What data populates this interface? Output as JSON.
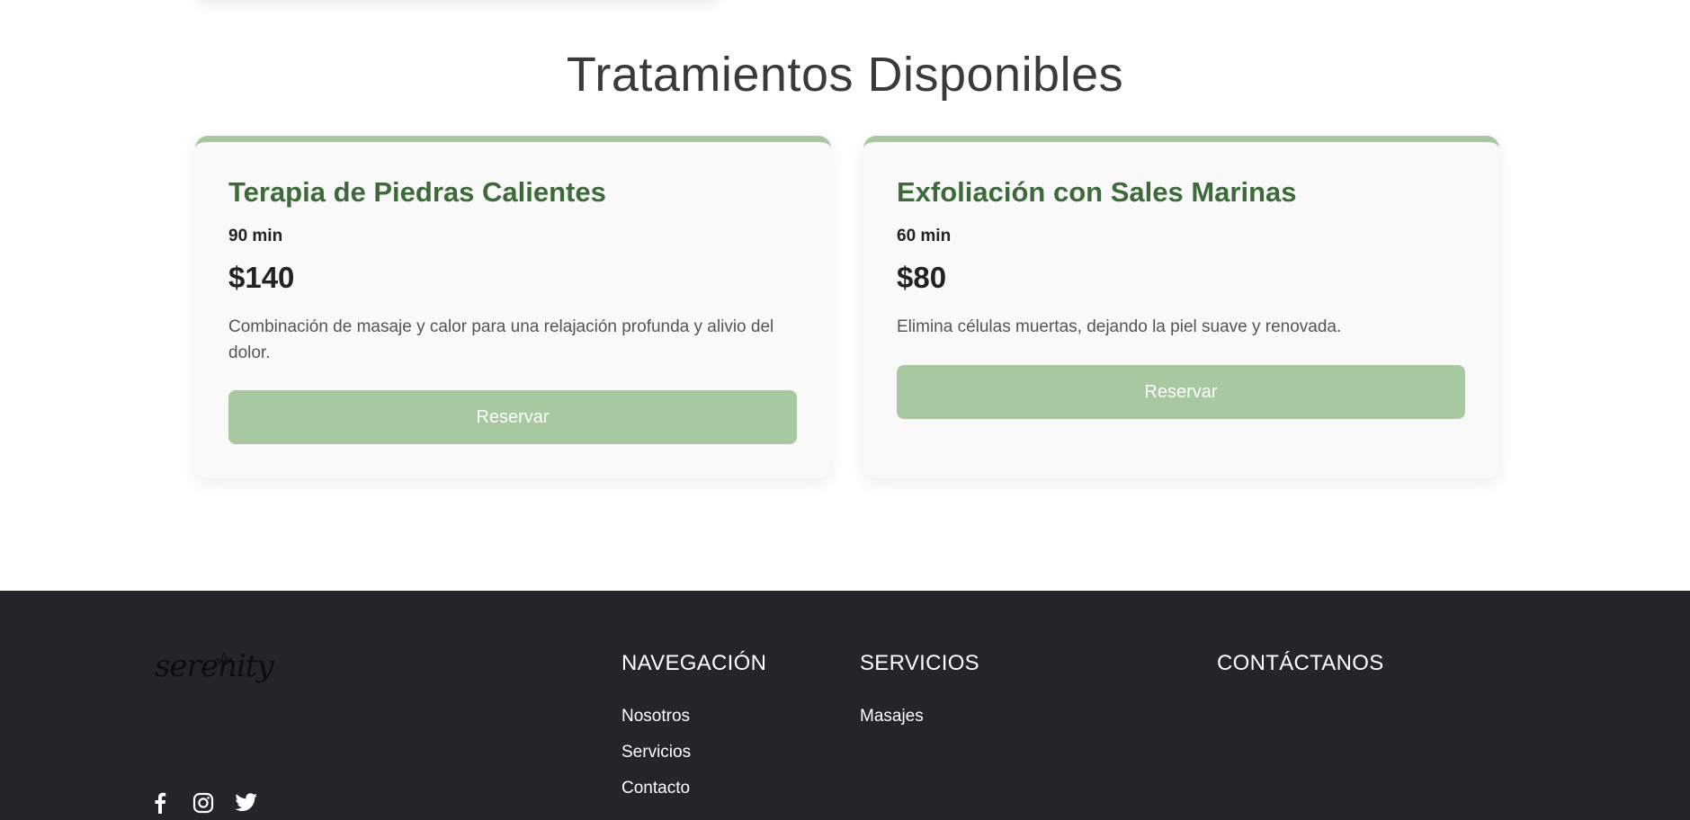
{
  "section": {
    "title": "Tratamientos Disponibles"
  },
  "treatments": [
    {
      "name": "Terapia de Piedras Calientes",
      "duration": "90 min",
      "price": "$140",
      "description": "Combinación de masaje y calor para una relajación profunda y alivio del dolor.",
      "button_label": "Reservar"
    },
    {
      "name": "Exfoliación con Sales Marinas",
      "duration": "60 min",
      "price": "$80",
      "description": "Elimina células muertas, dejando la piel suave y renovada.",
      "button_label": "Reservar"
    }
  ],
  "footer": {
    "logo_text": "serenity",
    "socials": [
      {
        "icon": "facebook-icon"
      },
      {
        "icon": "instagram-icon"
      },
      {
        "icon": "twitter-icon"
      }
    ],
    "navigation": {
      "title": "NAVEGACIÓN",
      "links": [
        "Nosotros",
        "Servicios",
        "Contacto"
      ]
    },
    "services": {
      "title": "SERVICIOS",
      "links": [
        "Masajes"
      ]
    },
    "contact": {
      "title": "CONTÁCTANOS"
    }
  },
  "colors": {
    "accent": "#a8c8a1",
    "title_green": "#3e6a3b",
    "footer_bg": "#222529"
  }
}
